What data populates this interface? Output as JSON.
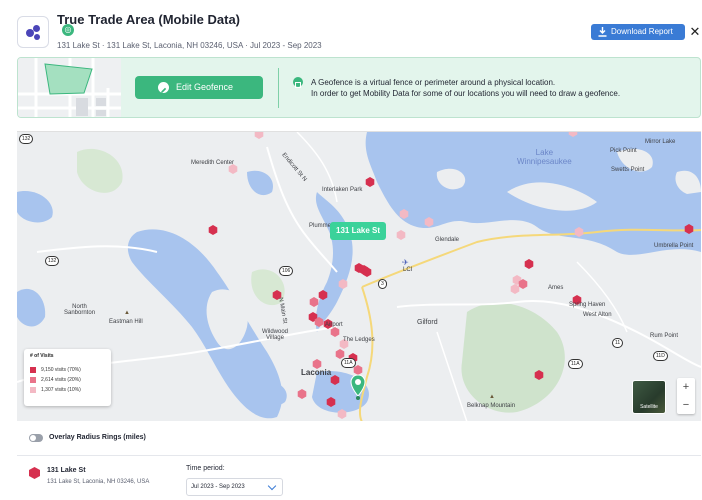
{
  "header": {
    "title": "True Trade Area (Mobile Data)",
    "subtitle": "131 Lake St · 131 Lake St, Laconia, NH 03246, USA · Jul 2023 - Sep 2023",
    "download_label": "Download Report",
    "close_label": "✕"
  },
  "geofence": {
    "edit_label": "Edit Geofence",
    "info_line1": "A Geofence is a virtual fence or perimeter around a physical location.",
    "info_line2": "In order to get Mobility Data for some of our locations you will need to draw a geofence."
  },
  "map": {
    "pin_label": "131 Lake St",
    "labels": {
      "meredith_center": "Meredith Center",
      "endicott": "Endicott St N",
      "interlaken": "Interlaken Park",
      "plummer": "Plummer",
      "glendale": "Glendale",
      "lci": "LCI",
      "north_sanbornton": "North\nSanbornton",
      "eastman_hill": "Eastman Hill",
      "wildwood": "Wildwood\nVillage",
      "n_main": "N Main St",
      "airport": "Airport",
      "the_ledges": "The Ledges",
      "laconia": "Laconia",
      "gilford": "Gilford",
      "ames": "Ames",
      "spring_haven": "Spring Haven",
      "west_alton": "West Alton",
      "rum_point": "Rum Point",
      "belknap": "Belknap Mountain",
      "lake": "Lake\nWinnipesaukee",
      "pick_point": "Pick Point",
      "mirror_lake": "Mirror Lake",
      "swetts_point": "Swetts Point",
      "umbrella_point": "Umbrella Point",
      "road_132a": "132",
      "road_132b": "132",
      "road_106": "106",
      "road_3": "3",
      "road_11a": "11A",
      "road_11": "11",
      "road_11d": "11D",
      "road_11a2": "11A"
    },
    "legend": {
      "title": "# of Visits",
      "items": [
        {
          "label": "9,150 visits (70%)",
          "color": "#d6304f"
        },
        {
          "label": "2,614 visits (20%)",
          "color": "#e9738a"
        },
        {
          "label": "1,307 visits (10%)",
          "color": "#f3b9c4"
        }
      ]
    },
    "satellite_label": "Satellite",
    "zoom_in": "+",
    "zoom_out": "−"
  },
  "overlay": {
    "label": "Overlay Radius Rings (miles)",
    "enabled": false
  },
  "location": {
    "name": "131 Lake St",
    "address": "131 Lake St, Laconia, NH 03246, USA",
    "period_label": "Time period:",
    "period_value": "Jul 2023 - Sep 2023"
  },
  "colors": {
    "accent_blue": "#3a7bd5",
    "accent_green": "#3bb77e",
    "hex_high": "#d6304f",
    "hex_mid": "#e9738a",
    "hex_low": "#f3b9c4",
    "water": "#a8c4ee"
  }
}
